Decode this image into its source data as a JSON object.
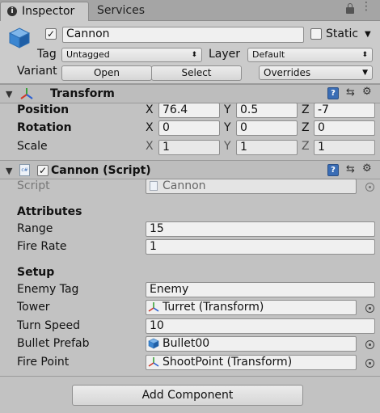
{
  "tabs": [
    {
      "label": "Inspector"
    },
    {
      "label": "Services"
    }
  ],
  "header": {
    "object_name": "Cannon",
    "active_checked": true,
    "static_label": "Static",
    "tag_label": "Tag",
    "tag_value": "Untagged",
    "layer_label": "Layer",
    "layer_value": "Default",
    "variant_label": "Variant",
    "open_label": "Open",
    "select_label": "Select",
    "overrides_label": "Overrides"
  },
  "transform": {
    "title": "Transform",
    "rows": [
      {
        "label": "Position",
        "x": "76.4",
        "y": "0.5",
        "z": "-7"
      },
      {
        "label": "Rotation",
        "x": "0",
        "y": "0",
        "z": "0"
      },
      {
        "label": "Scale",
        "x": "1",
        "y": "1",
        "z": "1"
      }
    ],
    "axis": {
      "x": "X",
      "y": "Y",
      "z": "Z"
    }
  },
  "script_component": {
    "title": "Cannon (Script)",
    "script_label": "Script",
    "script_value": "Cannon",
    "sections": {
      "attributes": "Attributes",
      "setup": "Setup"
    },
    "fields": {
      "range_label": "Range",
      "range_value": "15",
      "fire_rate_label": "Fire Rate",
      "fire_rate_value": "1",
      "enemy_tag_label": "Enemy Tag",
      "enemy_tag_value": "Enemy",
      "tower_label": "Tower",
      "tower_value": "Turret (Transform)",
      "turn_speed_label": "Turn Speed",
      "turn_speed_value": "10",
      "bullet_prefab_label": "Bullet Prefab",
      "bullet_prefab_value": "Bullet00",
      "fire_point_label": "Fire Point",
      "fire_point_value": "ShootPoint (Transform)"
    }
  },
  "add_component_label": "Add Component",
  "colors": {
    "panel": "#cbcbcb",
    "tab_bar": "#a5a5a5",
    "help_icon": "#3a6db5"
  }
}
